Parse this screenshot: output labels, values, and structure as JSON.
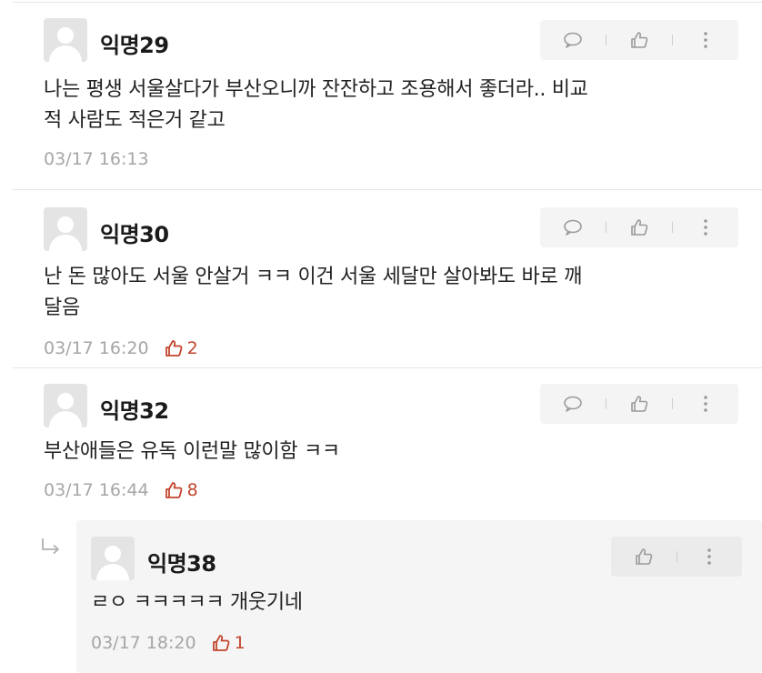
{
  "comments": [
    {
      "nickname": "익명29",
      "text_lines": [
        "나는 평생 서울살다가 부산오니까 잔잔하고 조용해서 좋더라.. 비교",
        "적 사람도 적은거 같고"
      ],
      "timestamp": "03/17 16:13",
      "likes": ""
    },
    {
      "nickname": "익명30",
      "text_lines": [
        "난 돈 많아도 서울 안살거 ㅋㅋ 이건 서울 세달만 살아봐도 바로 깨",
        "달음"
      ],
      "timestamp": "03/17 16:20",
      "likes": "2"
    },
    {
      "nickname": "익명32",
      "text_lines": [
        "부산애들은 유독 이런말 많이함 ㅋㅋ"
      ],
      "timestamp": "03/17 16:44",
      "likes": "8"
    }
  ],
  "reply": {
    "nickname": "익명38",
    "text_lines": [
      "ㄹㅇ ㅋㅋㅋㅋㅋ 개웃기네"
    ],
    "timestamp": "03/17 18:20",
    "likes": "1"
  },
  "icons": {
    "comment": "speech-bubble-icon",
    "vote": "thumbs-up-icon",
    "more": "vertical-dots-icon",
    "reply_indicator": "reply-arrow-icon"
  },
  "colors": {
    "like_accent": "#c2452d",
    "meta_gray": "#a6a6a6",
    "action_bg": "#f4f4f4",
    "reply_bg": "#f5f5f5"
  }
}
